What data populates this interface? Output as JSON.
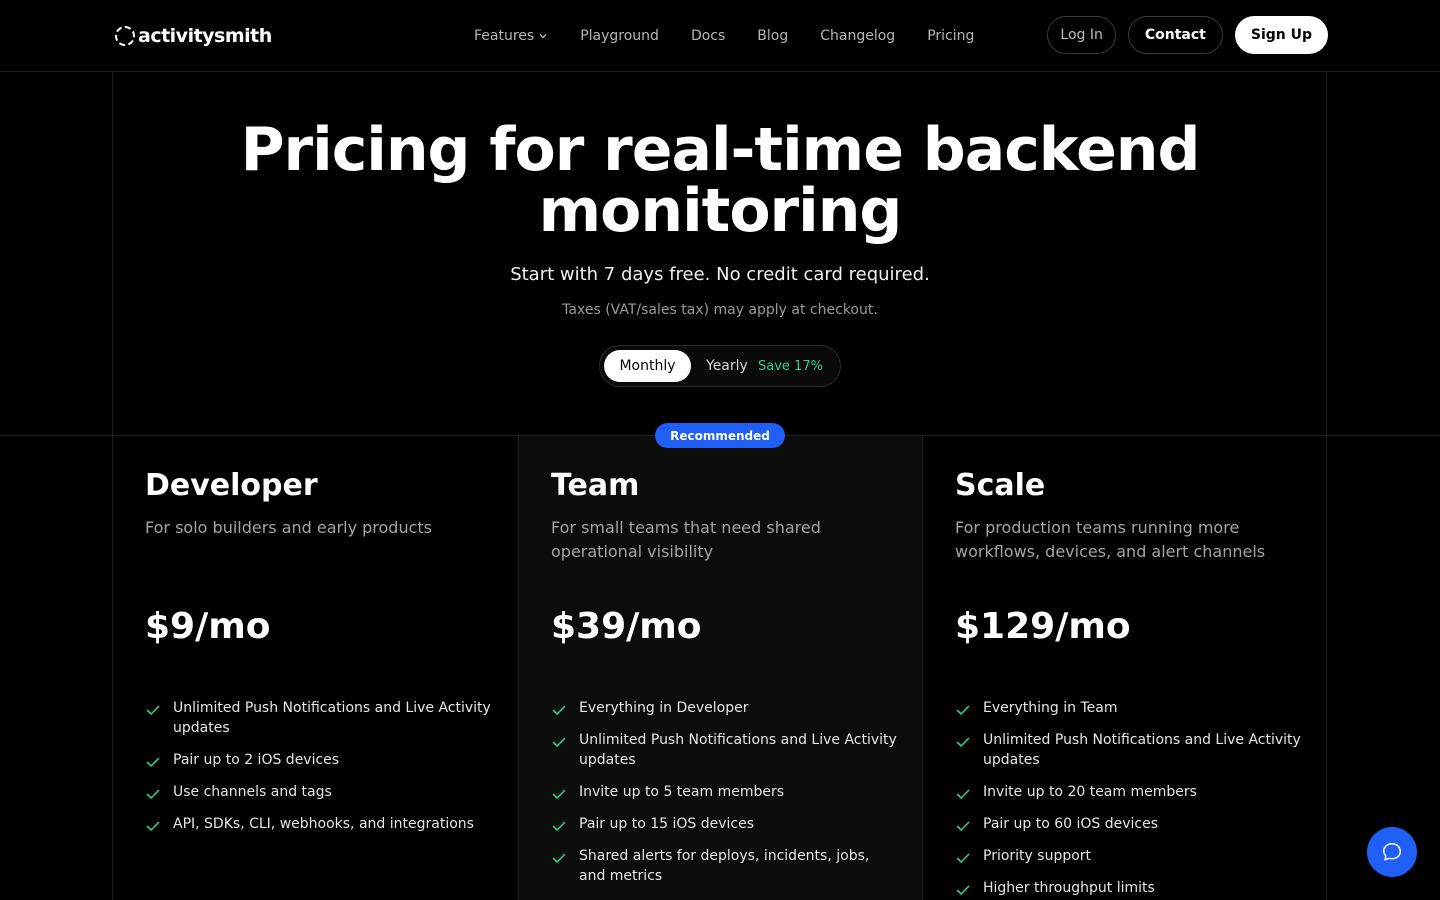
{
  "brand": {
    "name": "activitysmith"
  },
  "nav": {
    "links": [
      "Features",
      "Playground",
      "Docs",
      "Blog",
      "Changelog",
      "Pricing"
    ],
    "login": "Log In",
    "contact": "Contact",
    "signup": "Sign Up"
  },
  "hero": {
    "title": "Pricing for real-time backend monitoring",
    "subtitle": "Start with 7 days free. No credit card required.",
    "note": "Taxes (VAT/sales tax) may apply at checkout."
  },
  "billing_toggle": {
    "monthly": "Monthly",
    "yearly": "Yearly",
    "save": "Save 17%",
    "selected": "Monthly"
  },
  "badge": "Recommended",
  "plans": [
    {
      "name": "Developer",
      "description": "For solo builders and early products",
      "price": "$9/mo",
      "features": [
        "Unlimited Push Notifications and Live Activity updates",
        "Pair up to 2 iOS devices",
        "Use channels and tags",
        "API, SDKs, CLI, webhooks, and integrations"
      ]
    },
    {
      "name": "Team",
      "description": "For small teams that need shared operational visibility",
      "price": "$39/mo",
      "features": [
        "Everything in Developer",
        "Unlimited Push Notifications and Live Activity updates",
        "Invite up to 5 team members",
        "Pair up to 15 iOS devices",
        "Shared alerts for deploys, incidents, jobs, and metrics"
      ]
    },
    {
      "name": "Scale",
      "description": "For production teams running more workflows, devices, and alert channels",
      "price": "$129/mo",
      "features": [
        "Everything in Team",
        "Unlimited Push Notifications and Live Activity updates",
        "Invite up to 20 team members",
        "Pair up to 60 iOS devices",
        "Priority support",
        "Higher throughput limits"
      ]
    }
  ],
  "colors": {
    "accent": "#1f5ff5",
    "check": "#2bd389",
    "save": "#2bd389"
  },
  "icons": [
    "logo-mark-icon",
    "chevron-down-icon",
    "check-icon",
    "chat-bubble-icon"
  ]
}
